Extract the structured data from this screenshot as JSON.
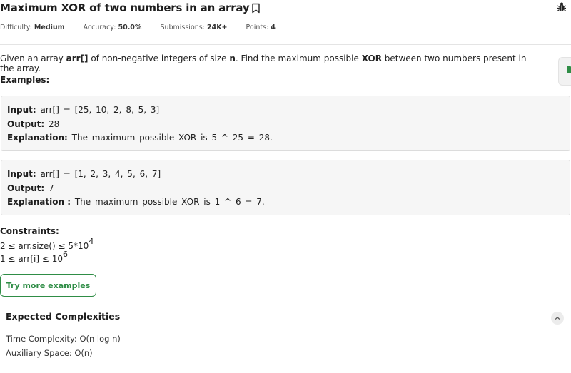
{
  "problem": {
    "title": "Maximum XOR of two numbers in an array",
    "icons": {
      "bookmark": "bookmark-icon",
      "bug": "bug-icon"
    }
  },
  "meta": {
    "difficulty_label": "Difficulty:",
    "difficulty_value": "Medium",
    "accuracy_label": "Accuracy:",
    "accuracy_value": "50.0%",
    "submissions_label": "Submissions:",
    "submissions_value": "24K+",
    "points_label": "Points:",
    "points_value": "4"
  },
  "description": {
    "p1": "Given an array ",
    "arr": "arr[]",
    "p2": " of non-negative integers of size ",
    "n": "n",
    "p3": ". Find the maximum possible ",
    "xor": "XOR",
    "p4": " between two numbers present in the array."
  },
  "examples_heading": "Examples:",
  "examples": [
    {
      "input_label": "Input:",
      "input": "arr[] = [25, 10, 2, 8, 5, 3]",
      "output_label": "Output:",
      "output": "28",
      "explanation_label": "Explanation:",
      "explanation": "The maximum possible XOR is 5 ^ 25 = 28."
    },
    {
      "input_label": "Input:",
      "input": "arr[] = [1, 2, 3, 4, 5, 6, 7]",
      "output_label": "Output:",
      "output": "7",
      "explanation_label": "Explanation :",
      "explanation": "The maximum possible XOR is 1 ^ 6 = 7."
    }
  ],
  "constraints": {
    "heading": "Constraints:",
    "c1_text": "2 ≤ arr.size() ≤ 5*10",
    "c1_exp": "4",
    "c2_text": "1 ≤ arr[i] ≤ 10",
    "c2_exp": "6"
  },
  "try_button": "Try more examples",
  "complexities": {
    "heading": "Expected Complexities",
    "time": "Time Complexity: O(n log n)",
    "space": "Auxiliary Space: O(n)",
    "toggle_icon": "chevron-up-icon"
  },
  "colors": {
    "accent": "#2f8d46",
    "example_bg": "#f6f6f6"
  }
}
